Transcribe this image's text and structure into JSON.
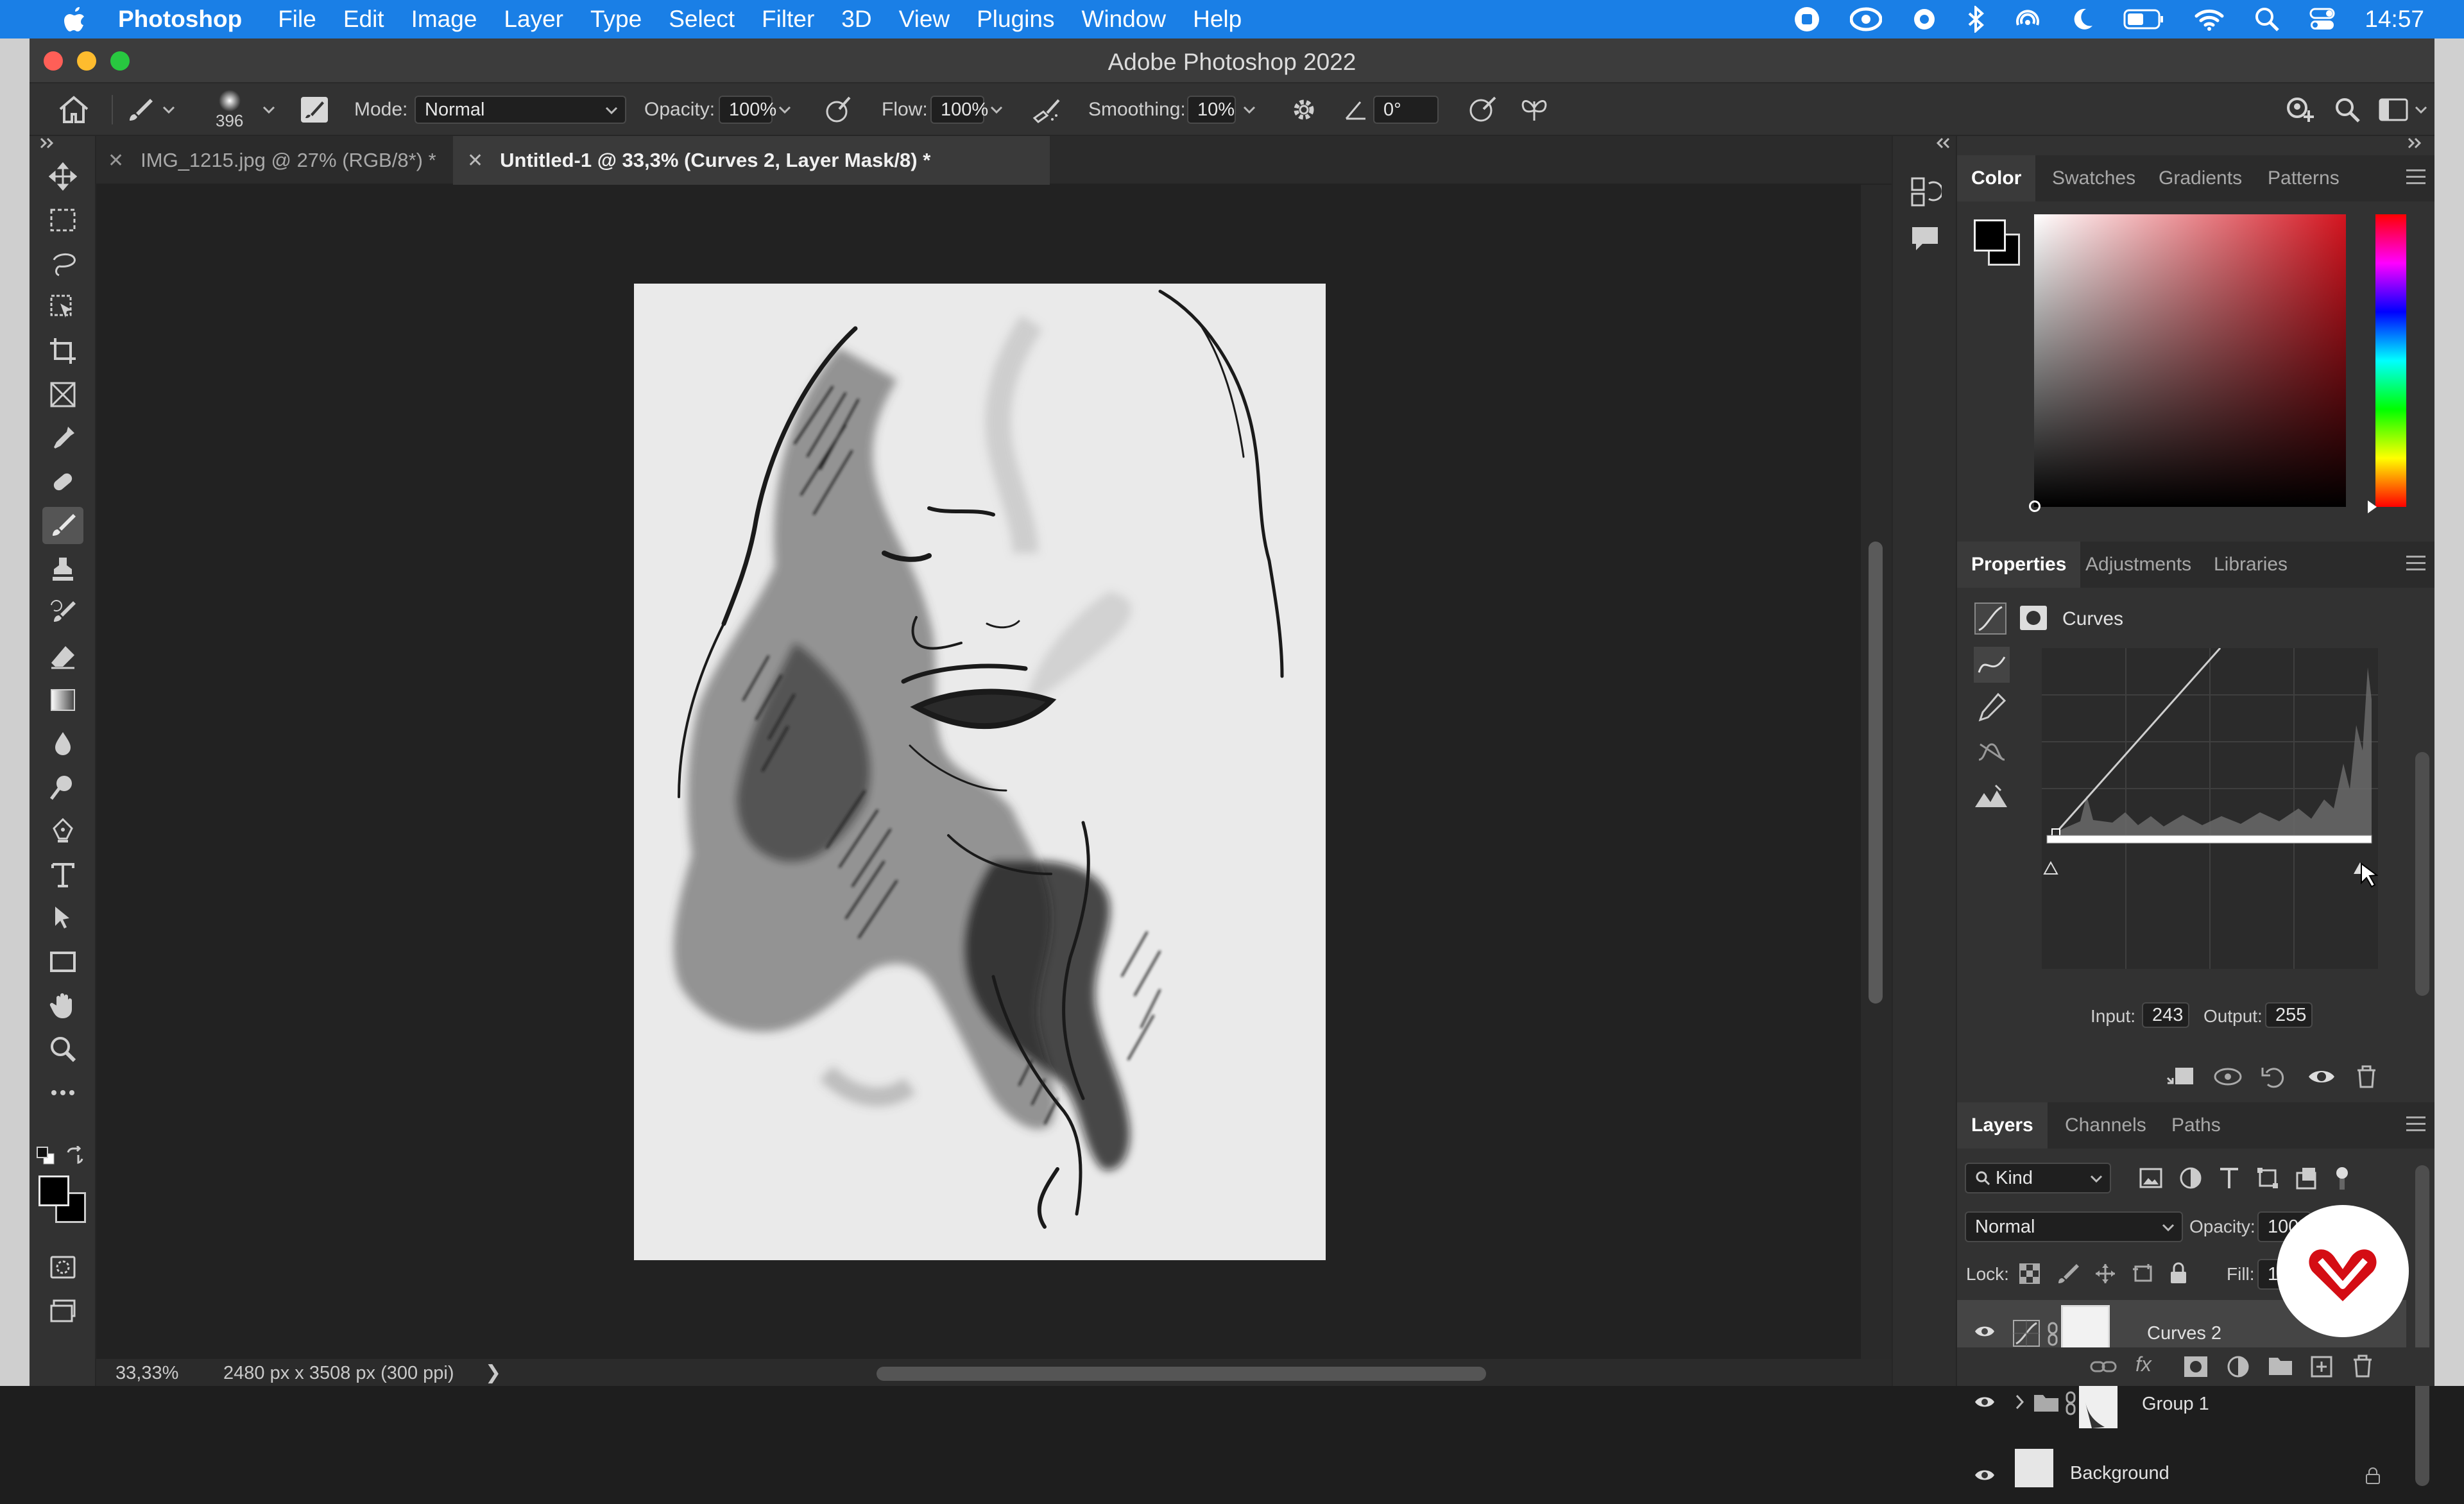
{
  "menubar": {
    "app": "Photoshop",
    "items": [
      "File",
      "Edit",
      "Image",
      "Layer",
      "Type",
      "Select",
      "Filter",
      "3D",
      "View",
      "Plugins",
      "Window",
      "Help"
    ],
    "time": "14:57"
  },
  "window": {
    "title": "Adobe Photoshop 2022"
  },
  "options": {
    "brush_size": "396",
    "mode_label": "Mode:",
    "mode_value": "Normal",
    "opacity_label": "Opacity:",
    "opacity_value": "100%",
    "flow_label": "Flow:",
    "flow_value": "100%",
    "smoothing_label": "Smoothing:",
    "smoothing_value": "10%",
    "angle_value": "0°"
  },
  "tabs": [
    {
      "label": "IMG_1215.jpg @ 27% (RGB/8*) *"
    },
    {
      "label": "Untitled-1 @ 33,3% (Curves 2, Layer Mask/8) *"
    }
  ],
  "status": {
    "zoom": "33,33%",
    "doc_info": "2480 px x 3508 px (300 ppi)"
  },
  "color_panel": {
    "tabs": [
      "Color",
      "Swatches",
      "Gradients",
      "Patterns"
    ]
  },
  "properties_panel": {
    "tabs": [
      "Properties",
      "Adjustments",
      "Libraries"
    ],
    "adjustment_name": "Curves",
    "input_label": "Input:",
    "input_value": "243",
    "output_label": "Output:",
    "output_value": "255"
  },
  "layers_panel": {
    "tabs": [
      "Layers",
      "Channels",
      "Paths"
    ],
    "filter_kind": "Kind",
    "blend_mode": "Normal",
    "opacity_label": "Opacity:",
    "opacity_value": "100%",
    "lock_label": "Lock:",
    "fill_label": "Fill:",
    "fill_value": "100%",
    "layers": [
      {
        "name": "Curves 2"
      },
      {
        "name": "Group 1"
      },
      {
        "name": "Background"
      }
    ]
  },
  "colors": {
    "menubar": "#1a7fe6",
    "accent_logo": "#d40d14"
  }
}
